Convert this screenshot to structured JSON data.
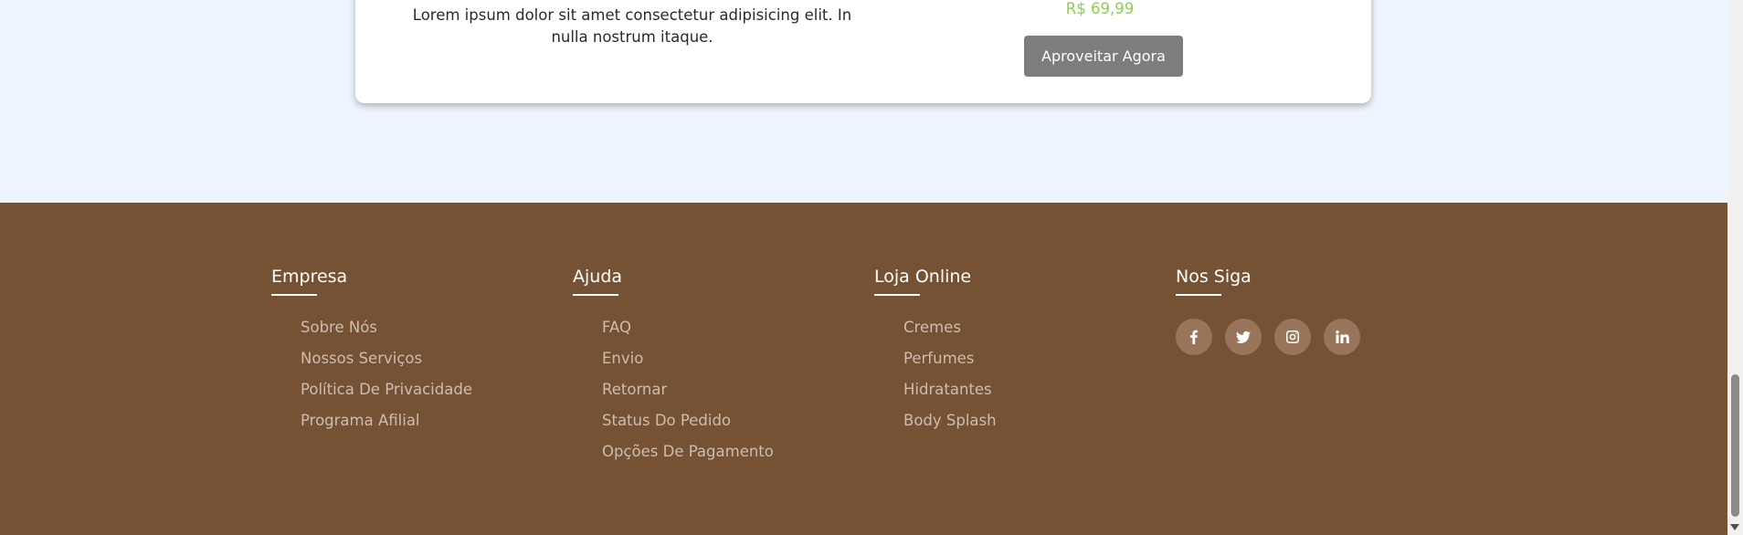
{
  "promo": {
    "description": "Lorem ipsum dolor sit amet consectetur adipisicing elit. In nulla nostrum itaque.",
    "price": "R$ 69,99",
    "button_label": "Aproveitar Agora",
    "price_color": "#8cd14d"
  },
  "footer": {
    "background_color": "#765234",
    "columns": [
      {
        "title": "Empresa",
        "links": [
          "Sobre Nós",
          "Nossos Serviços",
          "Política De Privacidade",
          "Programa Afilial"
        ]
      },
      {
        "title": "Ajuda",
        "links": [
          "FAQ",
          "Envio",
          "Retornar",
          "Status Do Pedido",
          "Opções De Pagamento"
        ]
      },
      {
        "title": "Loja Online",
        "links": [
          "Cremes",
          "Perfumes",
          "Hidratantes",
          "Body Splash"
        ]
      },
      {
        "title": "Nos Siga",
        "social": [
          "facebook-icon",
          "twitter-icon",
          "instagram-icon",
          "linkedin-icon"
        ]
      }
    ]
  }
}
